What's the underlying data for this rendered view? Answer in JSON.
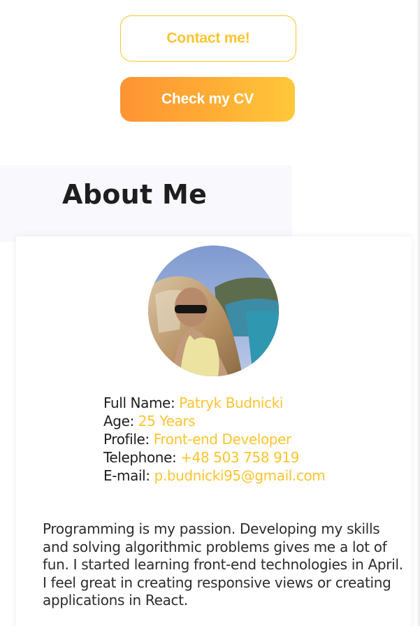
{
  "buttons": {
    "contact_label": "Contact me!",
    "cv_label": "Check my CV"
  },
  "about": {
    "title": "About Me",
    "profile_photo_icon": "profile-photo",
    "info": [
      {
        "label": "Full Name:",
        "value": "Patryk Budnicki"
      },
      {
        "label": "Age:",
        "value": "25 Years"
      },
      {
        "label": "Profile:",
        "value": "Front-end Developer"
      },
      {
        "label": "Telephone:",
        "value": "+48 503 758 919"
      },
      {
        "label": "E-mail:",
        "value": "p.budnicki95@gmail.com"
      }
    ],
    "bio": "Programming is my passion. Developing my skills and solving algorithmic problems gives me a lot of fun. I started learning front-end technologies in April. I feel great in creating responsive views or creating applications in React."
  },
  "colors": {
    "accent": "#fcc430",
    "gradient_start": "#fe9433",
    "gradient_end": "#ffc83a",
    "text": "#1e1e1e",
    "section_bg": "#f8f8fd"
  }
}
